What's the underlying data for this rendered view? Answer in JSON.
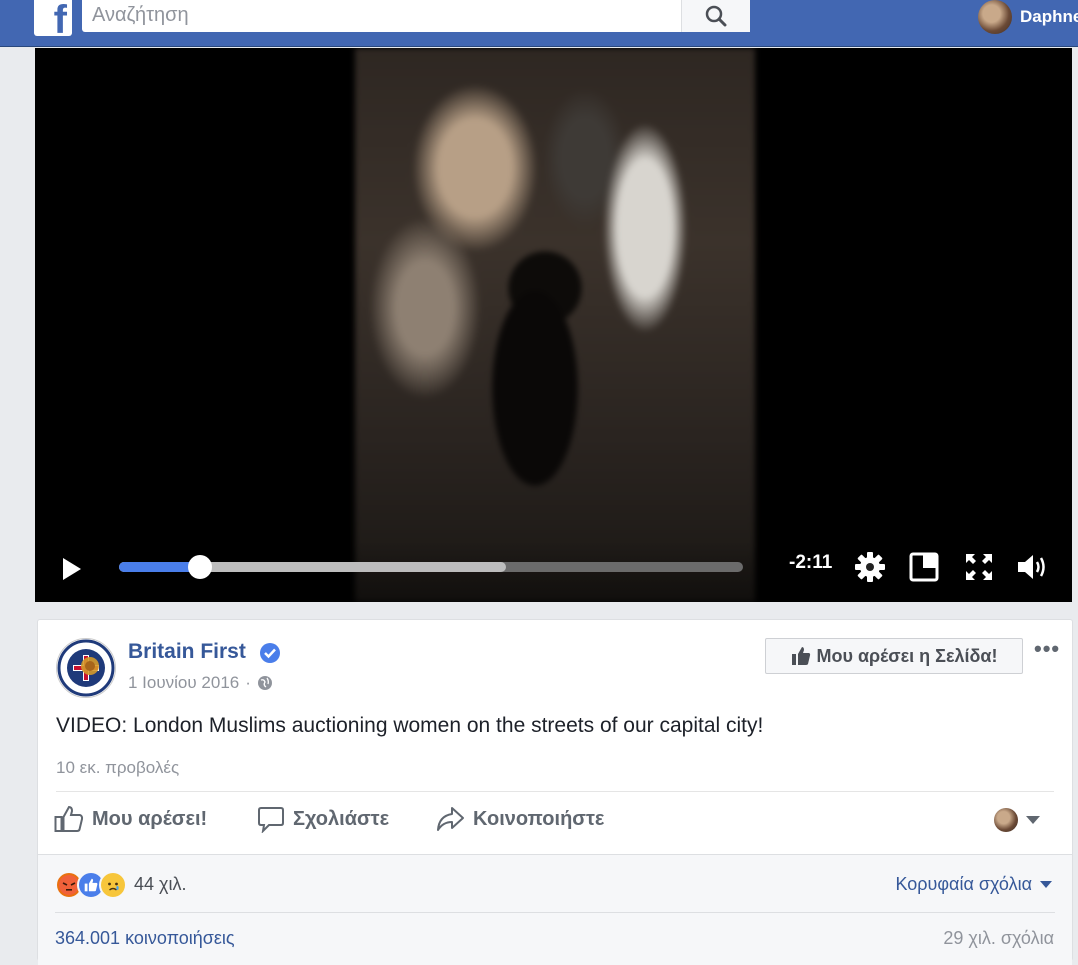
{
  "header": {
    "search_placeholder": "Αναζήτηση",
    "user_name": "Daphne"
  },
  "video": {
    "time_remaining": "-2:11",
    "progress_played": 0.13,
    "progress_buffered": 0.62
  },
  "post": {
    "page_name": "Britain First",
    "date": "1 Ιουνίου 2016",
    "like_page_label": "Μου αρέσει η Σελίδα!",
    "text": "VIDEO: London Muslims auctioning women on the streets of our capital city!",
    "views": "10 εκ. προβολές",
    "actions": {
      "like": "Μου αρέσει!",
      "comment": "Σχολιάστε",
      "share": "Κοινοποιήστε"
    },
    "reactions_count": "44 χιλ.",
    "top_comments": "Κορυφαία σχόλια",
    "shares": "364.001 κοινοποιήσεις",
    "comments": "29 χιλ. σχόλια"
  },
  "colors": {
    "brand": "#4267b2",
    "link": "#365899",
    "progress": "#4a7eea"
  }
}
